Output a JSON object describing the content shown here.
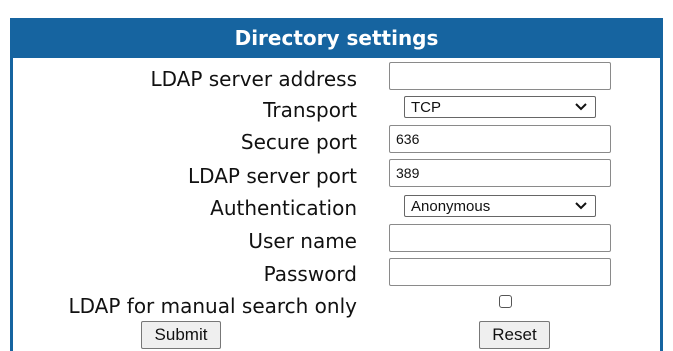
{
  "colors": {
    "header_bg": "#1664a0",
    "header_text": "#ffffff"
  },
  "panel": {
    "title": "Directory settings"
  },
  "fields": {
    "ldap_server_address": {
      "label": "LDAP server address",
      "value": ""
    },
    "transport": {
      "label": "Transport",
      "selected": "TCP"
    },
    "secure_port": {
      "label": "Secure port",
      "value": "636"
    },
    "ldap_server_port": {
      "label": "LDAP server port",
      "value": "389"
    },
    "authentication": {
      "label": "Authentication",
      "selected": "Anonymous"
    },
    "user_name": {
      "label": "User name",
      "value": ""
    },
    "password": {
      "label": "Password",
      "value": ""
    },
    "manual_search_only": {
      "label": "LDAP for manual search only",
      "checked": false
    }
  },
  "buttons": {
    "submit": "Submit",
    "reset": "Reset"
  }
}
